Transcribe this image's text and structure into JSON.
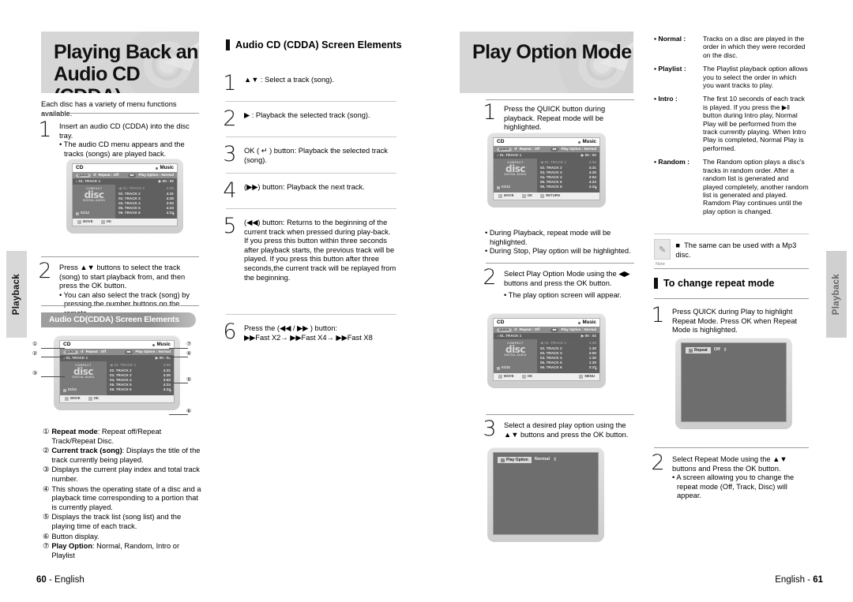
{
  "sidetabs": {
    "left": "Playback",
    "right": "Playback"
  },
  "left_page": {
    "banner_title": "Playing Back an Audio CD (CDDA)",
    "intro": "Each disc has a variety of menu functions available.",
    "steps": [
      {
        "num": "1",
        "line1": "Insert an audio CD (CDDA) into the disc tray.",
        "bullets": [
          "The audio CD menu appears and the tracks (songs) are played back."
        ]
      },
      {
        "num": "2",
        "line1": "Press ▲▼ buttons to select the track (song) to start playback from, and then press the OK button.",
        "bullets": [
          "You can also select the track (song) by pressing the number buttons on the remote."
        ]
      }
    ],
    "pill_title": "Audio CD(CDDA) Screen Elements",
    "legend": [
      {
        "n": "①",
        "term": "Repeat mode",
        "text": ": Repeat off/Repeat Track/Repeat Disc."
      },
      {
        "n": "②",
        "term": "Current track (song)",
        "text": ": Displays the title of the track currently being played."
      },
      {
        "n": "③",
        "term": "",
        "text": "Displays the current play index and total track number."
      },
      {
        "n": "④",
        "term": "",
        "text": "This shows the operating state of a disc and a playback time corresponding to a portion that is currently played."
      },
      {
        "n": "⑤",
        "term": "",
        "text": "Displays the track list (song list) and the playing time of each track."
      },
      {
        "n": "⑥",
        "term": "",
        "text": "Button display."
      },
      {
        "n": "⑦",
        "term": "Play Option",
        "text": ": Normal, Random, Intro or Playlist"
      }
    ],
    "footer": {
      "page": "60",
      "lang": "English"
    }
  },
  "mid_col": {
    "heading": "Audio CD (CDDA) Screen Elements",
    "items": [
      {
        "num": "1",
        "text": "▲▼ : Select a track (song)."
      },
      {
        "num": "2",
        "text": "▶ : Playback the selected track (song)."
      },
      {
        "num": "3",
        "text": "OK ( ↵ ) button: Playback the selected track (song)."
      },
      {
        "num": "4",
        "text": "(▶▶) button: Playback the next track."
      },
      {
        "num": "5",
        "text": "(◀◀) button: Returns to the beginning of the current track when pressed during play-back.\nIf you press this button within three seconds after playback starts, the previous track will be played. If you press this button after three seconds,the current track will be replayed from the beginning."
      },
      {
        "num": "6",
        "text": "Press the (◀◀ / ▶▶ ) button:\n▶▶Fast X2→ ▶▶Fast X4→ ▶▶Fast X8"
      }
    ]
  },
  "right_page": {
    "banner_title": "Play Option Mode",
    "steps": [
      {
        "num": "1",
        "line1": "Press the QUICK button during playback. Repeat mode will be highlighted.",
        "bullets": [
          "During Playback, repeat mode will be highlighted.",
          "During Stop, Play option will be highlighted."
        ]
      },
      {
        "num": "2",
        "line1": "Select Play Option Mode using the ◀▶ buttons and press the OK button.",
        "bullets": [
          "The play option screen will appear."
        ]
      },
      {
        "num": "3",
        "line1": "Select a desired play option using the ▲▼ buttons and press the OK button.",
        "bullets": []
      }
    ],
    "defs": [
      {
        "term": "• Normal :",
        "desc": "Tracks on a disc are played in the order in which they were recorded on the disc."
      },
      {
        "term": "• Playlist :",
        "desc": "The Playlist playback option allows you to select the order in which you want tracks to play."
      },
      {
        "term": "• Intro :",
        "desc": "The first 10 seconds of each track is played. If you press the ▶‖ button during Intro play, Normal Play will be performed from the track currently playing. When Intro Play is completed, Normal Play is performed."
      },
      {
        "term": "• Random :",
        "desc": "The Random option plays a disc's tracks in random order. After a random list is generated and played completely, another random list is generated and played. Ramdom Play continues until the play option is changed."
      }
    ],
    "note": {
      "label": "Note",
      "text": "The same can be used with a Mp3 disc."
    },
    "repeat_heading": "To change repeat mode",
    "repeat_steps": [
      {
        "num": "1",
        "line1": "Press QUICK during Play to highlight Repeat Mode. Press OK when Repeat Mode is highlighted.",
        "bullets": []
      },
      {
        "num": "2",
        "line1": "Select Repeat Mode using the ▲▼ buttons and Press the OK button.",
        "bullets": [
          "A screen allowing you to change the repeat mode (Off, Track, Disc) will appear."
        ]
      }
    ],
    "footer": {
      "lang": "English",
      "page": "61"
    }
  },
  "osd_a": {
    "title": "CD",
    "corner": "Music",
    "chip1": "QUICK",
    "repeat": "Repeat : Off",
    "play_option": "Play Option : Normal",
    "current_track": "01. TRACK 1",
    "time": "00 : 02",
    "index": "01/12",
    "cd_logo": {
      "l1": "COMPACT",
      "l2": "disc",
      "l3": "DIGITAL AUDIO"
    },
    "tracks": [
      {
        "name": "01. TRACK 1",
        "time": "4:55"
      },
      {
        "name": "02. TRACK 2",
        "time": "4:31"
      },
      {
        "name": "03. TRACK 3",
        "time": "4:30"
      },
      {
        "name": "04. TRACK 4",
        "time": "3:53"
      },
      {
        "name": "05. TRACK 5",
        "time": "4:23"
      },
      {
        "name": "06. TRACK 6",
        "time": "4:24"
      }
    ],
    "footer_keys": [
      "MOVE",
      "OK"
    ]
  },
  "osd_b": {
    "title": "CD",
    "corner": "Music",
    "chip1": "QUICK",
    "repeat": "Repeat : Off",
    "play_option": "Play Option : Normal",
    "current_track": "01. TRACK 1",
    "time": "00 : 02",
    "index": "01/12",
    "cd_logo": {
      "l1": "COMPACT",
      "l2": "disc",
      "l3": "DIGITAL AUDIO"
    },
    "tracks": [
      {
        "name": "01. TRACK 1",
        "time": "4:55"
      },
      {
        "name": "02. TRACK 2",
        "time": "4:31"
      },
      {
        "name": "03. TRACK 3",
        "time": "4:30"
      },
      {
        "name": "04. TRACK 4",
        "time": "3:53"
      },
      {
        "name": "05. TRACK 5",
        "time": "4:23"
      },
      {
        "name": "06. TRACK 6",
        "time": "4:24"
      }
    ],
    "footer_keys": [
      "MOVE",
      "OK",
      "RETURN"
    ]
  },
  "osd_c": {
    "title": "CD",
    "corner": "Music",
    "chip1": "QUICK",
    "repeat": "Repeat : Off",
    "play_option": "Play Option : Normal",
    "current_track": "01. TRACK 1",
    "time": "00 : 02",
    "index": "01/31",
    "cd_logo": {
      "l1": "COMPACT",
      "l2": "disc",
      "l3": "DIGITAL AUDIO"
    },
    "tracks": [
      {
        "name": "01. TRACK 1",
        "time": "1:45"
      },
      {
        "name": "02. TRACK 2",
        "time": "1:30"
      },
      {
        "name": "03. TRACK 3",
        "time": "3:00"
      },
      {
        "name": "04. TRACK 4",
        "time": "1:30"
      },
      {
        "name": "05. TRACK 5",
        "time": "1:30"
      },
      {
        "name": "06. TRACK 6",
        "time": "3:37"
      }
    ],
    "footer_keys": [
      "MOVE",
      "OK",
      "MENU"
    ]
  },
  "play_option_panel": {
    "tag": "Play Option",
    "value": "Normal"
  },
  "repeat_panel": {
    "tag": "Repeat",
    "value": "Off"
  }
}
